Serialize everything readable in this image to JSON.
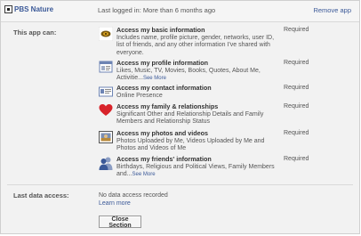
{
  "header": {
    "app_name": "PBS Nature",
    "last_logged": "Last logged in: More than 6 months ago",
    "remove_label": "Remove app"
  },
  "permissions_section": {
    "label": "This app can:",
    "items": [
      {
        "icon": "app-logo-icon",
        "title": "Access my basic information",
        "description": "Includes name, profile picture, gender, networks, user ID, list of friends, and any other information I've shared with everyone.",
        "see_more": "",
        "status": "Required"
      },
      {
        "icon": "profile-info-icon",
        "title": "Access my profile information",
        "description": "Likes, Music, TV, Movies, Books, Quotes, About Me, Activitie...",
        "see_more": "See More",
        "status": "Required"
      },
      {
        "icon": "contact-card-icon",
        "title": "Access my contact information",
        "description": "Online Presence",
        "see_more": "",
        "status": "Required"
      },
      {
        "icon": "heart-icon",
        "title": "Access my family & relationships",
        "description": "Significant Other and Relationship Details and Family Members and Relationship Status",
        "see_more": "",
        "status": "Required"
      },
      {
        "icon": "photo-icon",
        "title": "Access my photos and videos",
        "description": "Photos Uploaded by Me, Videos Uploaded by Me and Photos and Videos of Me",
        "see_more": "",
        "status": "Required"
      },
      {
        "icon": "friends-icon",
        "title": "Access my friends' information",
        "description": "Birthdays, Religious and Political Views, Family Members and...",
        "see_more": "See More",
        "status": "Required"
      }
    ]
  },
  "data_access": {
    "label": "Last data access:",
    "text": "No data access recorded",
    "link": "Learn more"
  },
  "close_button": "Close Section",
  "colors": {
    "link": "#3b5998",
    "panel_bg": "#f2f2f2",
    "heart": "#d8232a"
  }
}
